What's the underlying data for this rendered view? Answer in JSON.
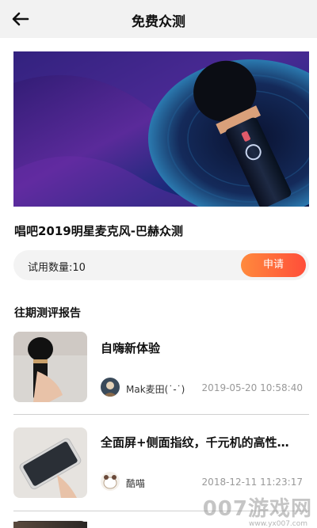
{
  "header": {
    "title": "免费众测",
    "back_icon": "arrow-left-icon"
  },
  "product": {
    "title": "唱吧2019明星麦克风-巴赫众测",
    "trial_label": "试用数量:10",
    "apply_label": "申请"
  },
  "section": {
    "title": "往期测评报告"
  },
  "reports": [
    {
      "title": "自嗨新体验",
      "user": "Mak麦田(˙-˙)",
      "time": "2019-05-20 10:58:40"
    },
    {
      "title": "全面屏+侧面指纹，千元机的高性…",
      "user": "酷喵",
      "time": "2018-12-11 11:23:17"
    }
  ],
  "watermark": {
    "text": "007游戏网",
    "url": "www.yx007.com"
  },
  "colors": {
    "accent_start": "#ff8a3d",
    "accent_end": "#ff4e3a",
    "header_bg": "#f2f2f2"
  }
}
